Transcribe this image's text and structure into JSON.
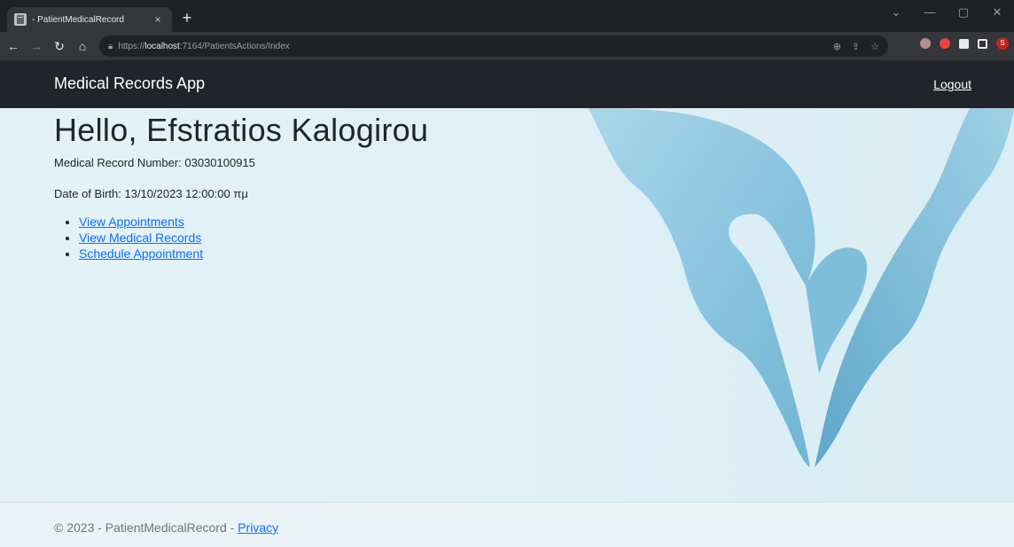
{
  "browser": {
    "tab_title": "- PatientMedicalRecord",
    "tab_close": "×",
    "new_tab": "+",
    "url_scheme": "https://",
    "url_host": "localhost",
    "url_rest": ":7164/PatientsActions/Index",
    "profile_initial": "S"
  },
  "navbar": {
    "brand": "Medical Records App",
    "logout": "Logout"
  },
  "patient": {
    "greeting": "Hello, Efstratios Kalogirou",
    "record_number": "Medical Record Number: 03030100915",
    "date_of_birth": "Date of Birth: 13/10/2023 12:00:00 πμ"
  },
  "links": [
    {
      "label": "View Appointments"
    },
    {
      "label": "View Medical Records"
    },
    {
      "label": "Schedule Appointment"
    }
  ],
  "footer": {
    "prefix": "© 2023 - PatientMedicalRecord - ",
    "privacy": "Privacy"
  },
  "colors": {
    "navbar": "#212529",
    "link": "#0d6efd",
    "glove": "#8cc7e0"
  }
}
